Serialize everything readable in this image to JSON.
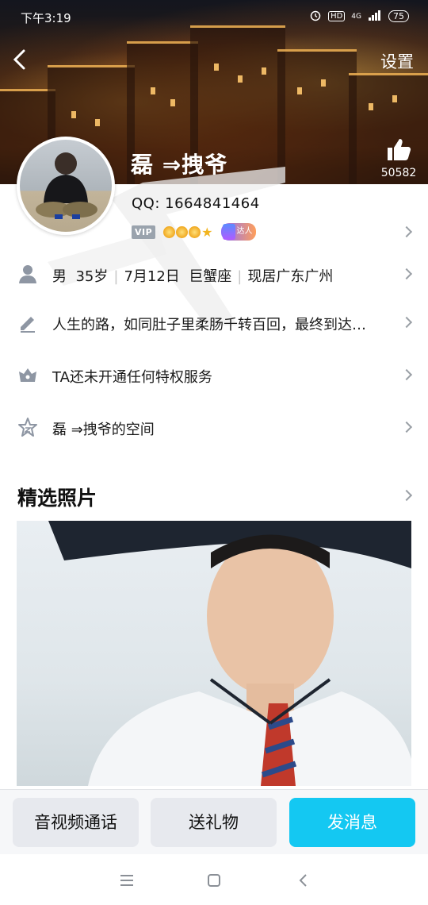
{
  "status_bar": {
    "time": "下午3:19",
    "network": "4G",
    "battery": "75",
    "hd_label": "HD"
  },
  "header": {
    "settings_label": "设置",
    "username": "磊 ⇒拽爷",
    "like_count": "50582"
  },
  "profile": {
    "qq_line": "QQ: 1664841464",
    "vip_label": "VIP",
    "daren_label": "达人"
  },
  "info_rows": {
    "basic": {
      "gender": "男",
      "age": "35岁",
      "birthday": "7月12日",
      "zodiac": "巨蟹座",
      "location": "现居广东广州"
    },
    "signature": "人生的路，如同肚子里柔肠千转百回，最终到达…",
    "privilege": "TA还未开通任何特权服务",
    "space": "磊 ⇒拽爷的空间"
  },
  "photos": {
    "title": "精选照片"
  },
  "actions": {
    "call_label": "音视频通话",
    "gift_label": "送礼物",
    "message_label": "发消息"
  },
  "colors": {
    "accent": "#14c8f2",
    "icon_gray": "#8e96a3",
    "chevron_gray": "#9aa0a6"
  }
}
